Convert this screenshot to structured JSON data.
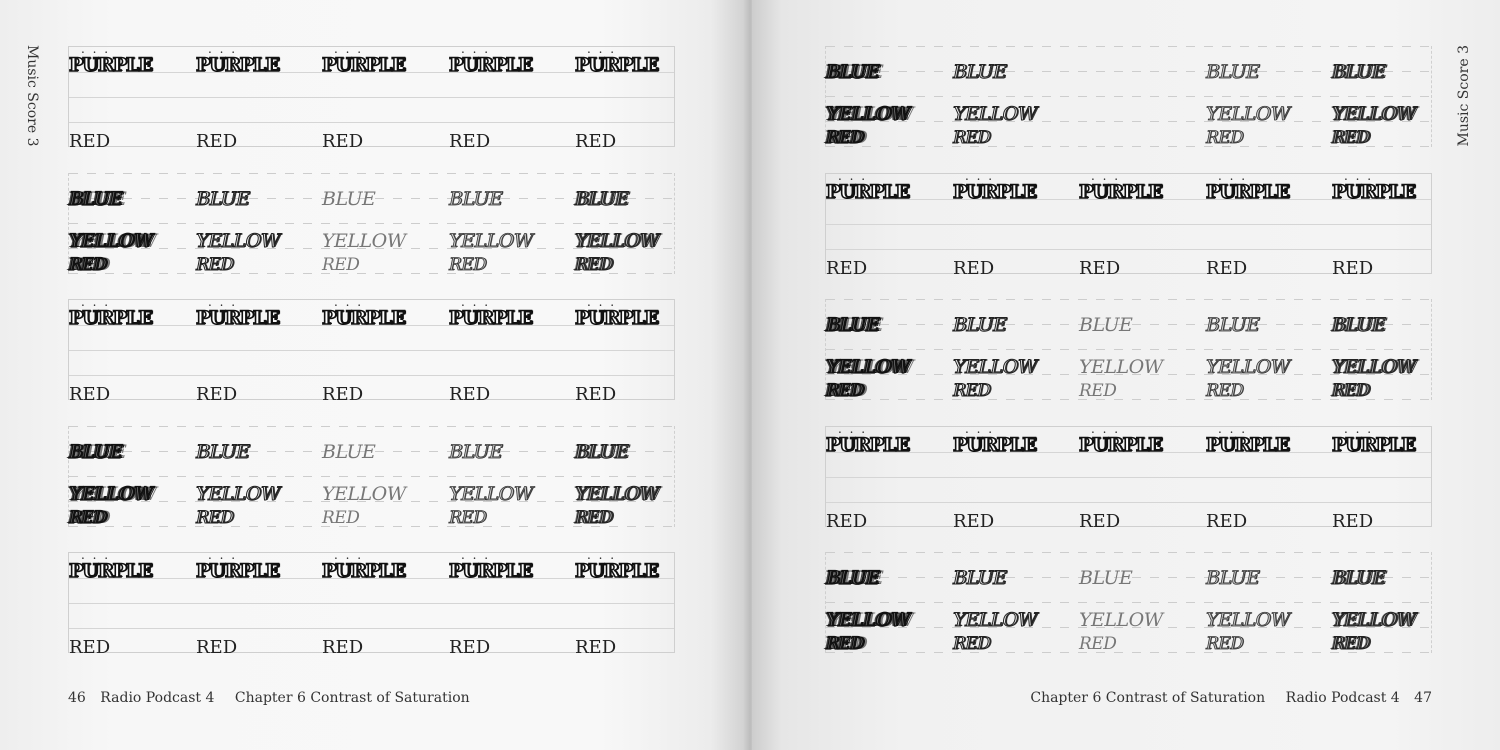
{
  "spread": {
    "left": {
      "page_label": "Music Score 3",
      "footer": {
        "page_number": "46",
        "title": "Radio Podcast 4",
        "chapter": "Chapter 6 Contrast of Saturation"
      },
      "blocks": [
        "purple",
        "color",
        "purple",
        "color",
        "purple"
      ]
    },
    "right": {
      "page_label": "Music Score 3",
      "footer": {
        "page_number": "47",
        "title": "Radio Podcast 4",
        "chapter": "Chapter 6 Contrast of Saturation"
      },
      "blocks": [
        "color-partial",
        "purple",
        "color",
        "purple",
        "color"
      ]
    }
  },
  "words": {
    "dots": ". . .",
    "purple": "PURPLE",
    "red": "RED",
    "blue": "BLUE",
    "yellow": "YELLOW"
  },
  "colors": {
    "ink": "#111111",
    "rule": "#cfcfcf"
  }
}
